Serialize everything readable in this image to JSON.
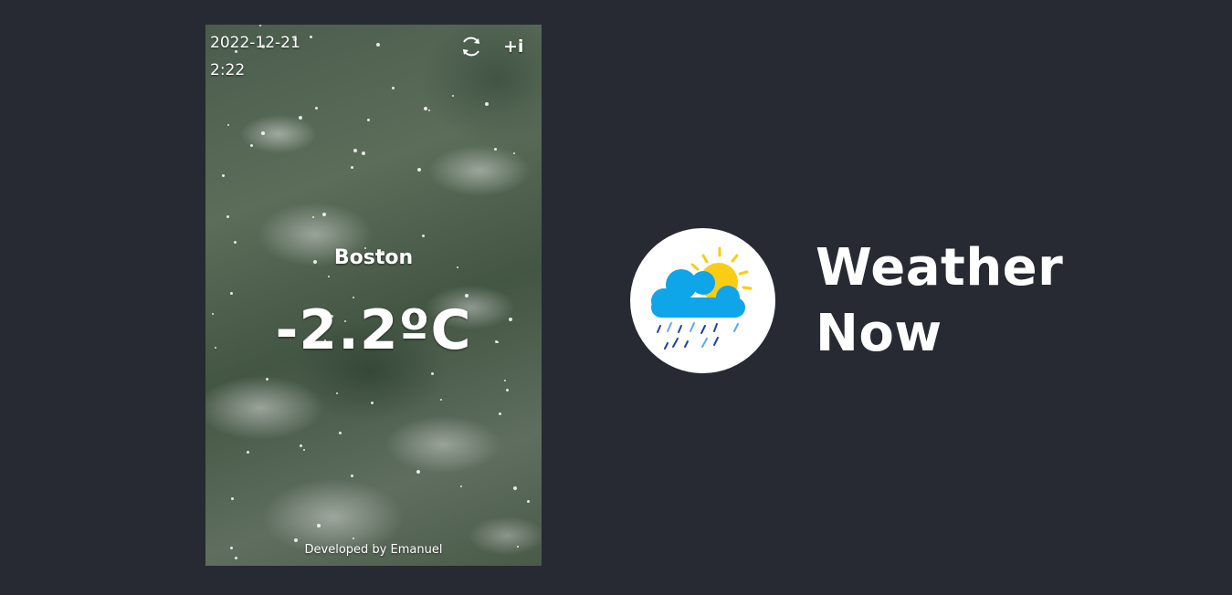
{
  "app": {
    "date": "2022-12-21",
    "time": "2:22",
    "city": "Boston",
    "temperature": "-2.2ºC",
    "footer": "Developed by Emanuel",
    "info_label": "+i",
    "icons": {
      "refresh": "refresh-icon",
      "weather": "cloud-sun-rain-icon"
    }
  },
  "brand": {
    "title_line1": "Weather",
    "title_line2": "Now"
  },
  "colors": {
    "page_background": "#272a33",
    "cloud": "#0ea5e9",
    "sun": "#facc15",
    "rain_dark": "#1e40af",
    "rain_light": "#60a5fa"
  }
}
